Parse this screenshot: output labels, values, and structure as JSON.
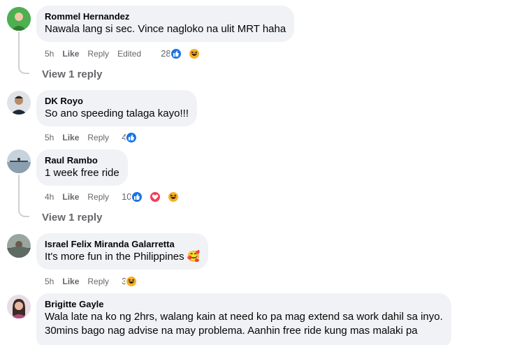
{
  "comments": [
    {
      "author": "Rommel Hernandez",
      "text": "Nawala lang si sec. Vince nagloko na ulit MRT haha",
      "time": "5h",
      "like": "Like",
      "reply": "Reply",
      "edited": "Edited",
      "reaction_count": "28",
      "reactions": [
        "like-icon",
        "haha-icon"
      ],
      "view_replies": "View 1 reply"
    },
    {
      "author": "DK Royo",
      "text": "So ano speeding talaga kayo!!!",
      "time": "5h",
      "like": "Like",
      "reply": "Reply",
      "reaction_count": "4",
      "reactions": [
        "like-icon"
      ]
    },
    {
      "author": "Raul Rambo",
      "text": "1 week free ride",
      "time": "4h",
      "like": "Like",
      "reply": "Reply",
      "reaction_count": "10",
      "reactions": [
        "like-icon",
        "heart-icon",
        "haha-icon"
      ],
      "view_replies": "View 1 reply"
    },
    {
      "author": "Israel Felix Miranda Galarretta",
      "text": "It's more fun in the Philippines 🥰",
      "time": "5h",
      "like": "Like",
      "reply": "Reply",
      "reaction_count": "3",
      "reactions": [
        "haha-icon"
      ]
    },
    {
      "author": "Brigitte Gayle",
      "text_lines": [
        "Wala late na ko ng 2hrs, walang kain at need ko pa mag extend sa work dahil sa inyo.",
        "30mins bago nag advise na may problema. Aanhin free ride kung mas malaki pa"
      ]
    }
  ],
  "colors": {
    "bubble": "#f0f2f5",
    "secondary_text": "#65676b",
    "like_blue": "#1b74e4",
    "heart_red": "#f33e58",
    "haha_yellow": "#f7b125"
  }
}
